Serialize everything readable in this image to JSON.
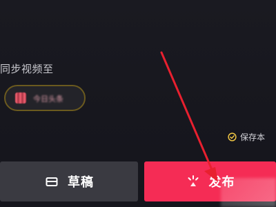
{
  "sync": {
    "label": "同步视频至",
    "app_chip": {
      "label": "今日头条",
      "icon": "app-icon",
      "border_color": "#6b5a1e"
    }
  },
  "save_local": {
    "label": "保存本",
    "icon": "check-circle-icon",
    "checked": true
  },
  "actions": {
    "draft_label": "草稿",
    "draft_icon": "draft-box-icon",
    "publish_label": "发布",
    "publish_icon": "sparkle-icon"
  },
  "colors": {
    "background": "#17171e",
    "publish_button": "#f52c55",
    "draft_button": "#3a3a41",
    "check_accent": "#f2c744",
    "annotation_arrow": "#e8202f"
  }
}
